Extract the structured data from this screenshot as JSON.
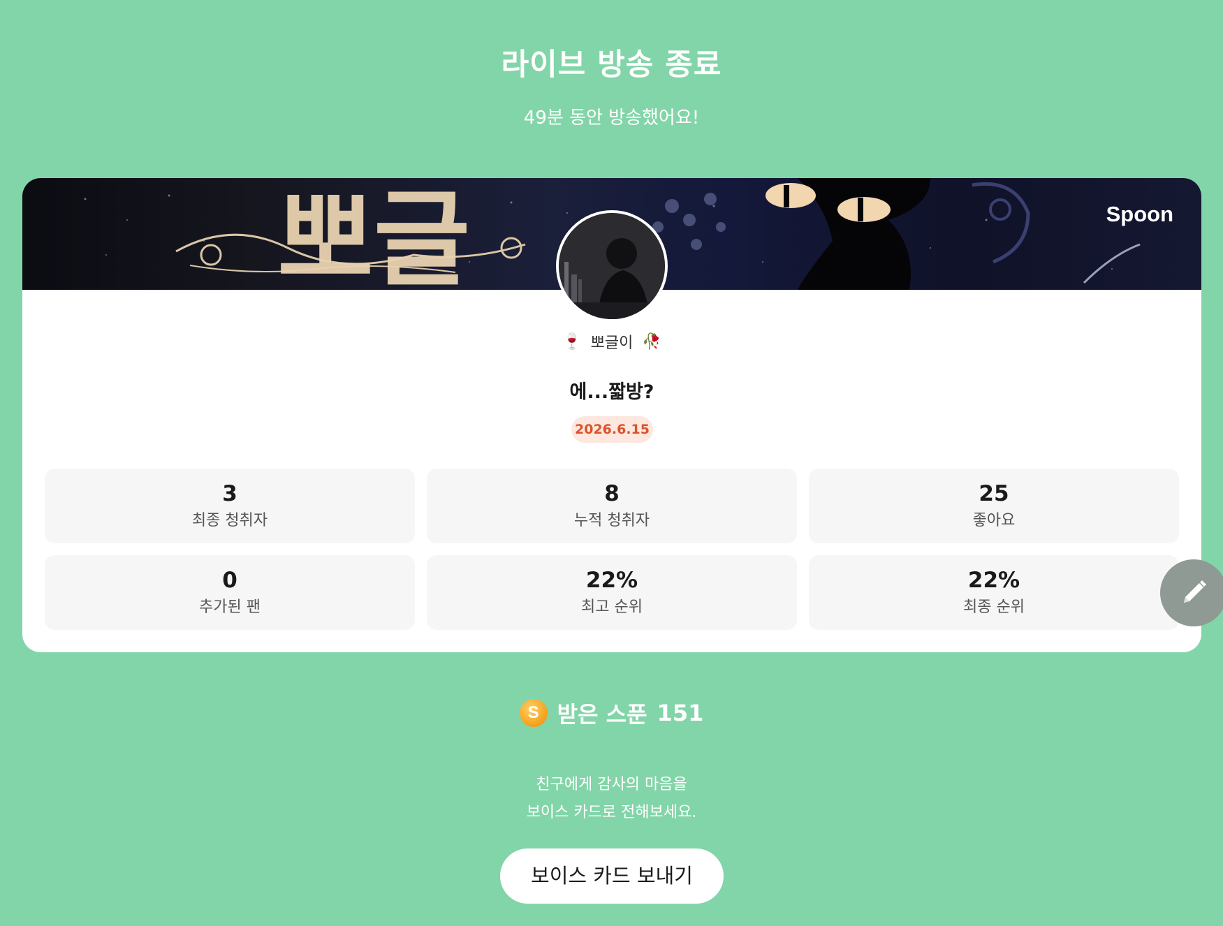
{
  "header": {
    "title": "라이브 방송 종료",
    "subtitle": "49분 동안 방송했어요!"
  },
  "banner": {
    "brand": "Spoon",
    "artwork_text": "뽀글"
  },
  "profile": {
    "nickname": "뽀글이",
    "emoji_left": "🍷",
    "emoji_right": "🥀"
  },
  "live": {
    "title": "에...짧방?",
    "date": "2026.6.15"
  },
  "stats": [
    {
      "value": "3",
      "label": "최종 청취자"
    },
    {
      "value": "8",
      "label": "누적 청취자"
    },
    {
      "value": "25",
      "label": "좋아요"
    },
    {
      "value": "0",
      "label": "추가된 팬"
    },
    {
      "value": "22%",
      "label": "최고 순위"
    },
    {
      "value": "22%",
      "label": "최종 순위"
    }
  ],
  "spoons": {
    "coin_symbol": "S",
    "label": "받은 스푼",
    "count": "151"
  },
  "message": {
    "line1": "친구에게 감사의 마음을",
    "line2": "보이스 카드로 전해보세요."
  },
  "actions": {
    "voice_card_label": "보이스 카드 보내기"
  },
  "colors": {
    "background": "#82d5a8",
    "date_badge_bg": "#fde7df",
    "date_badge_text": "#d9542a",
    "coin": "#f6a623"
  },
  "icons": {
    "fab": "pencil-icon",
    "coin": "spoon-coin-icon"
  }
}
